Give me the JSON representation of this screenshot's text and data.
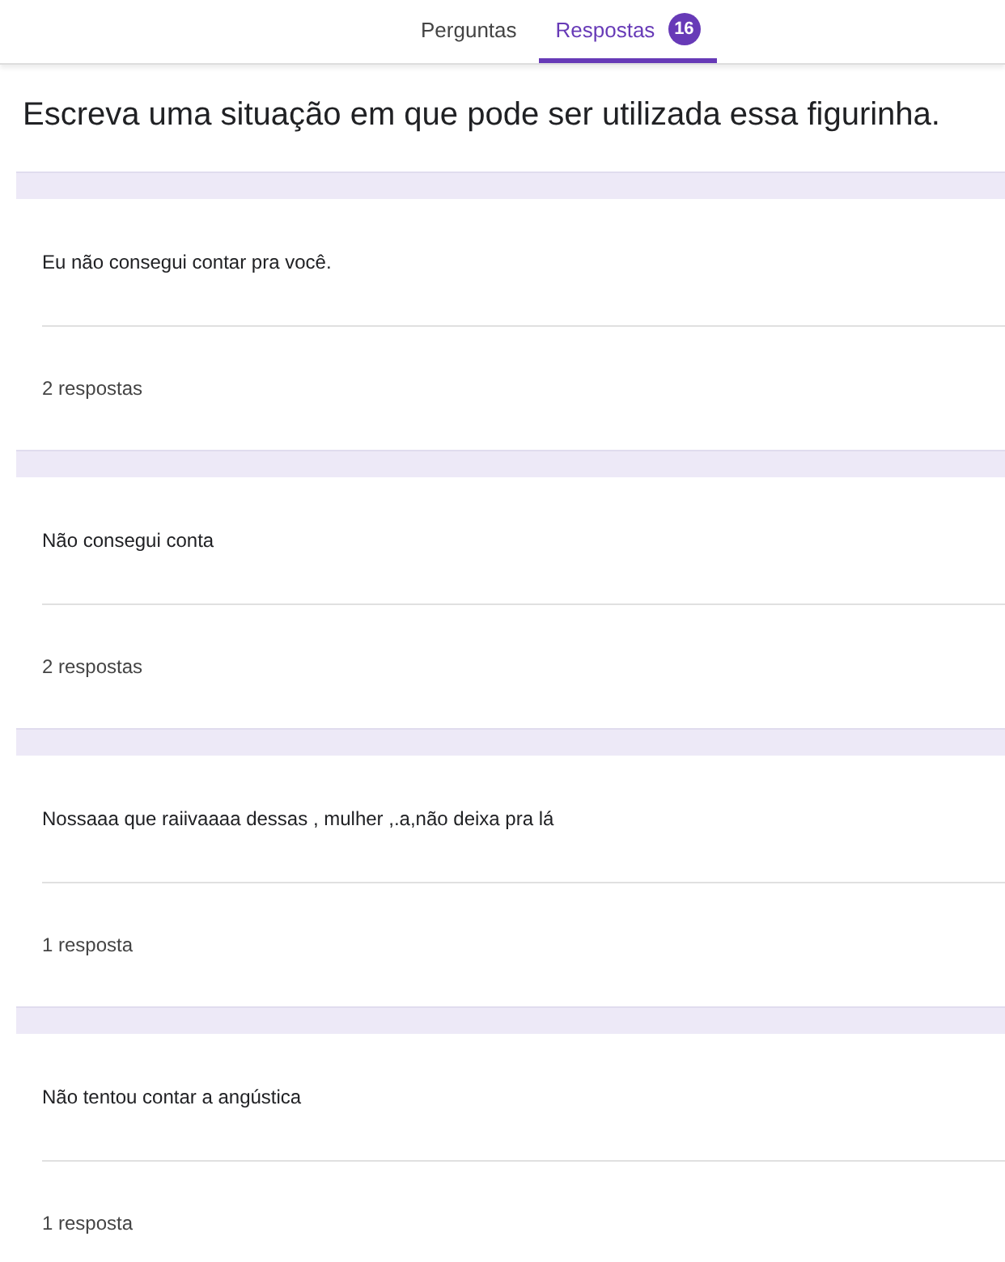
{
  "tabs": [
    {
      "label": "Perguntas",
      "selected": false
    },
    {
      "label": "Respostas",
      "selected": true,
      "badge": "16"
    }
  ],
  "question": {
    "title": "Escreva uma situação em que pode ser utilizada essa figurinha."
  },
  "answers": [
    {
      "text": "Eu não consegui contar pra você.",
      "count": "2 respostas"
    },
    {
      "text": "Não consegui conta",
      "count": "2 respostas"
    },
    {
      "text": "Nossaaa que raiivaaaa dessas , mulher ,.a,não deixa pra lá",
      "count": "1 resposta"
    },
    {
      "text": "Não tentou contar a angústica",
      "count": "1 resposta"
    }
  ]
}
